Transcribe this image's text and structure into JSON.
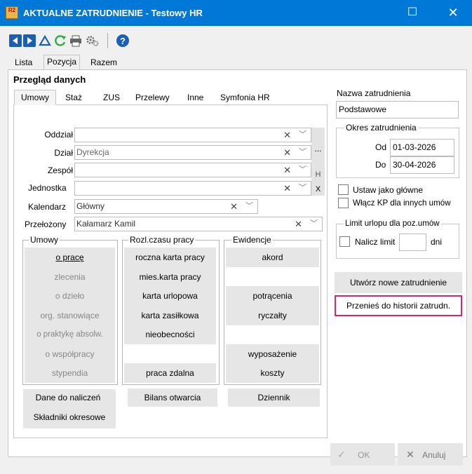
{
  "window": {
    "logo": "R2",
    "title": "AKTUALNE ZATRUDNIENIE - Testowy HR"
  },
  "toolbar": {
    "icons": [
      "prev-icon",
      "next-icon",
      "triangle-icon",
      "refresh-icon",
      "print-icon",
      "settings-icon",
      "help-icon"
    ],
    "help": "?"
  },
  "tabs": [
    "Lista",
    "Pozycja",
    "Razem"
  ],
  "section_title": "Przegląd danych",
  "subtabs": [
    "Umowy",
    "Staż",
    "ZUS",
    "Przelewy",
    "Inne",
    "Symfonia HR"
  ],
  "fields": {
    "oddzial": {
      "label": "Oddział",
      "value": ""
    },
    "dzial": {
      "label": "Dział",
      "value": "Dyrekcja"
    },
    "zespol": {
      "label": "Zespół",
      "value": ""
    },
    "jednostka": {
      "label": "Jednostka",
      "value": ""
    },
    "kalendarz": {
      "label": "Kalendarz",
      "value": "Główny"
    },
    "przelozony": {
      "label": "Przełożony",
      "value": "Kałamarz Kamil"
    }
  },
  "side_buttons": {
    "more": "...",
    "h": "H",
    "x": "X"
  },
  "groups": {
    "umowy": {
      "title": "Umowy",
      "items": [
        "o pracę",
        "zlecenia",
        "o dzieło",
        "org. stanowiące",
        "o praktykę absolw.",
        "o współpracy",
        "stypendia"
      ]
    },
    "rozl": {
      "title": "Rozl.czasu pracy",
      "items": [
        "roczna karta pracy",
        "mies.karta pracy",
        "karta urlopowa",
        "karta zasiłkowa",
        "nieobecności",
        "",
        "praca zdalna"
      ]
    },
    "ewid": {
      "title": "Ewidencje",
      "items": [
        "akord",
        "",
        "potrącenia",
        "ryczałty",
        "",
        "wyposażenie",
        "koszty"
      ]
    }
  },
  "bottom_buttons": {
    "dane": "Dane do naliczeń",
    "skladniki": "Składniki okresowe",
    "bilans": "Bilans otwarcia",
    "dziennik": "Dziennik"
  },
  "right": {
    "nazwa_label": "Nazwa zatrudnienia",
    "nazwa_value": "Podstawowe",
    "okres_title": "Okres zatrudnienia",
    "od_label": "Od",
    "od_value": "01-03-2026",
    "do_label": "Do",
    "do_value": "30-04-2026",
    "ustaw": "Ustaw jako główne",
    "wlacz": "Włącz KP dla innych umów",
    "limit_title": "Limit urlopu dla poz.umów",
    "nalicz": "Nalicz limit",
    "dni": "dni",
    "utworz": "Utwórz nowe zatrudnienie",
    "przenies": "Przenieś do historii zatrudn.",
    "highlight_color": "#e0245e"
  },
  "footer": {
    "ok": "OK",
    "anuluj": "Anuluj"
  }
}
